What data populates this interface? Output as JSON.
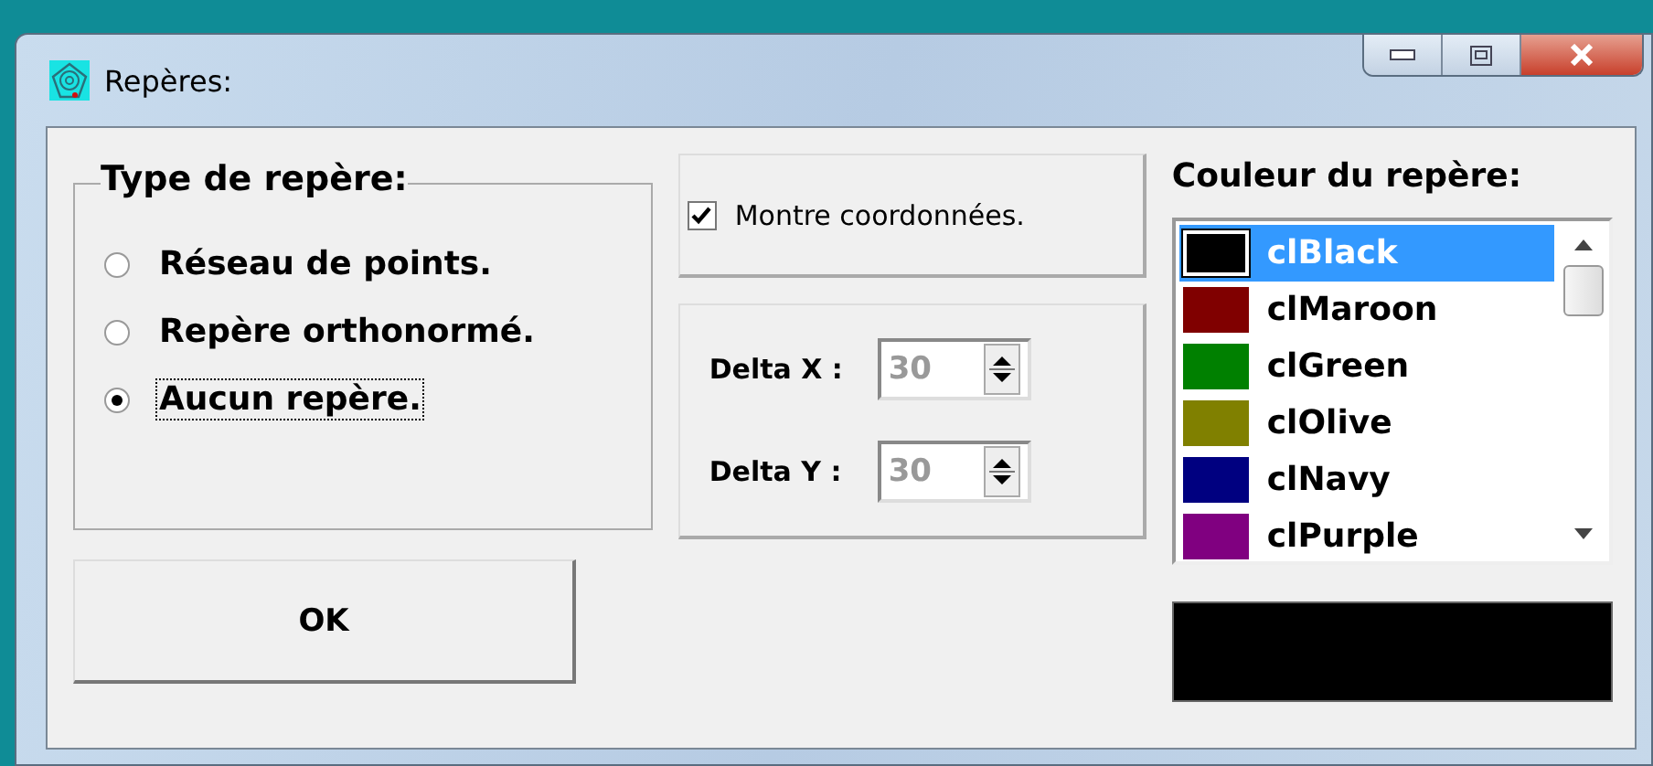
{
  "window": {
    "title": "Repères:"
  },
  "marker_type": {
    "title": "Type de repère:",
    "options": [
      {
        "label": "Réseau de points.",
        "selected": false
      },
      {
        "label": "Repère orthonormé.",
        "selected": false
      },
      {
        "label": "Aucun repère.",
        "selected": true
      }
    ]
  },
  "ok_button": "OK",
  "show_coordinates": {
    "label": "Montre coordonnées.",
    "checked": true
  },
  "deltas": [
    {
      "label": "Delta X :",
      "value": "30",
      "disabled": true
    },
    {
      "label": "Delta Y :",
      "value": "30",
      "disabled": true
    }
  ],
  "color_list": {
    "title": "Couleur du repère:",
    "items": [
      {
        "label": "clBlack",
        "color": "#000000",
        "selected": true
      },
      {
        "label": "clMaroon",
        "color": "#800000",
        "selected": false
      },
      {
        "label": "clGreen",
        "color": "#008000",
        "selected": false
      },
      {
        "label": "clOlive",
        "color": "#808000",
        "selected": false
      },
      {
        "label": "clNavy",
        "color": "#000080",
        "selected": false
      },
      {
        "label": "clPurple",
        "color": "#800080",
        "selected": false
      }
    ]
  }
}
